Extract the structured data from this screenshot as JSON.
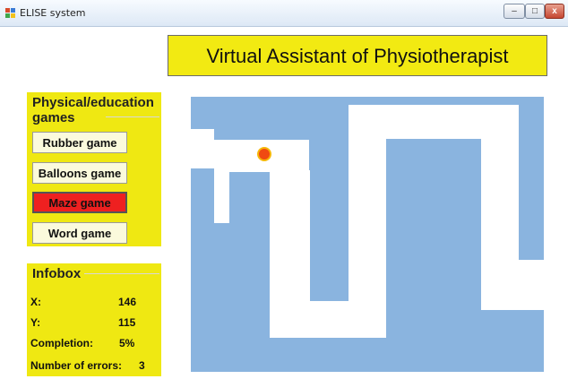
{
  "window": {
    "title": "ELISE system",
    "min_glyph": "–",
    "max_glyph": "□",
    "close_glyph": "x"
  },
  "header": {
    "title": "Virtual Assistant of Physiotherapist"
  },
  "games": {
    "heading": "Physical/education games",
    "buttons": [
      {
        "label": "Rubber game",
        "active": false
      },
      {
        "label": "Balloons game",
        "active": false
      },
      {
        "label": "Maze game",
        "active": true
      },
      {
        "label": "Word game",
        "active": false
      }
    ]
  },
  "infobox": {
    "heading": "Infobox",
    "x_label": "X:",
    "x_value": "146",
    "y_label": "Y:",
    "y_value": "115",
    "completion_label": "Completion:",
    "completion_value": "5%",
    "errors_label": "Number of errors:",
    "errors_value": "3"
  },
  "colors": {
    "panel": "#efe812",
    "header": "#f2ea12",
    "maze_wall": "#8ab4df",
    "maze_path": "#ffffff",
    "active_button": "#ee2020",
    "ball": "#f04a12"
  },
  "maze": {
    "ball_icon": "ball-icon"
  }
}
